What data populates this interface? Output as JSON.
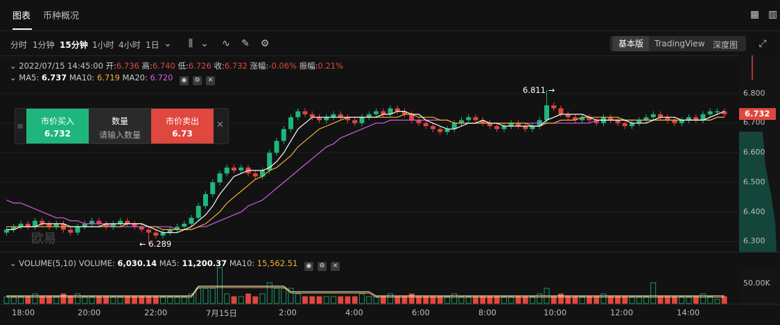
{
  "tabs": [
    {
      "label": "图表"
    },
    {
      "label": "币种概况"
    }
  ],
  "toolbar": {
    "timeframes": [
      "分时",
      "1分钟",
      "15分钟",
      "1小时",
      "4小时",
      "1日"
    ],
    "active_timeframe": "15分钟",
    "versions": [
      "基本版",
      "TradingView",
      "深度图"
    ],
    "active_version": "基本版"
  },
  "info": {
    "datetime": "2022/07/15 14:45:00",
    "open_label": "开:",
    "open": "6.736",
    "high_label": "高:",
    "high": "6.740",
    "low_label": "低:",
    "low": "6.726",
    "close_label": "收:",
    "close": "6.732",
    "change_label": "涨幅:",
    "change": "-0.06%",
    "amp_label": "振幅:",
    "amp": "0.21%",
    "ma5_label": "MA5:",
    "ma5": "6.737",
    "ma10_label": "MA10:",
    "ma10": "6.719",
    "ma20_label": "MA20:",
    "ma20": "6.720"
  },
  "trade": {
    "buy_label": "市价买入",
    "buy_price": "6.732",
    "qty_label": "数量",
    "qty_placeholder": "请输入数量",
    "sell_label": "市价卖出",
    "sell_price": "6.73"
  },
  "annotations": {
    "high_marker": "6.811 →",
    "low_marker": "← 6.289"
  },
  "current_price": "6.732",
  "watermark": "欧易",
  "price_axis": [
    "6.800",
    "6.700",
    "6.600",
    "6.500",
    "6.400",
    "6.300"
  ],
  "volume": {
    "header": "VOLUME(5,10)",
    "vol_label": "VOLUME:",
    "vol": "6,030.14",
    "ma5_label": "MA5:",
    "ma5": "11,200.37",
    "ma10_label": "MA10:",
    "ma10": "15,562.51",
    "axis": "50.00K"
  },
  "time_axis": [
    "18:00",
    "20:00",
    "22:00",
    "7月15日",
    "2:00",
    "4:00",
    "6:00",
    "8:00",
    "10:00",
    "12:00",
    "14:00"
  ],
  "colors": {
    "up": "#1fb67e",
    "down": "#e0473e",
    "ma5": "#ffffff",
    "ma10": "#f5b23c",
    "ma20": "#d35ee8"
  },
  "chart_data": {
    "type": "candlestick",
    "price_axis_ticks": [
      6.8,
      6.7,
      6.6,
      6.5,
      6.4,
      6.3
    ],
    "high_marked": 6.811,
    "low_marked": 6.289,
    "closes": [
      6.34,
      6.35,
      6.36,
      6.35,
      6.37,
      6.36,
      6.35,
      6.36,
      6.34,
      6.33,
      6.35,
      6.36,
      6.37,
      6.36,
      6.35,
      6.36,
      6.37,
      6.36,
      6.35,
      6.34,
      6.33,
      6.32,
      6.33,
      6.34,
      6.35,
      6.36,
      6.38,
      6.42,
      6.46,
      6.5,
      6.53,
      6.55,
      6.54,
      6.55,
      6.53,
      6.52,
      6.54,
      6.6,
      6.64,
      6.68,
      6.72,
      6.74,
      6.73,
      6.72,
      6.71,
      6.72,
      6.73,
      6.72,
      6.71,
      6.7,
      6.72,
      6.73,
      6.74,
      6.73,
      6.75,
      6.74,
      6.73,
      6.71,
      6.7,
      6.69,
      6.68,
      6.67,
      6.68,
      6.7,
      6.71,
      6.72,
      6.71,
      6.7,
      6.69,
      6.68,
      6.69,
      6.7,
      6.69,
      6.68,
      6.69,
      6.71,
      6.76,
      6.75,
      6.73,
      6.72,
      6.71,
      6.72,
      6.71,
      6.7,
      6.72,
      6.71,
      6.7,
      6.69,
      6.7,
      6.71,
      6.72,
      6.73,
      6.72,
      6.71,
      6.7,
      6.71,
      6.72,
      6.71,
      6.73,
      6.74,
      6.74,
      6.73
    ],
    "ma5": [
      6.34,
      6.34,
      6.35,
      6.35,
      6.35,
      6.36,
      6.36,
      6.36,
      6.36,
      6.35,
      6.35,
      6.35,
      6.35,
      6.35,
      6.36,
      6.36,
      6.36,
      6.36,
      6.36,
      6.36,
      6.35,
      6.34,
      6.33,
      6.33,
      6.33,
      6.34,
      6.35,
      6.37,
      6.39,
      6.42,
      6.46,
      6.49,
      6.52,
      6.53,
      6.54,
      6.54,
      6.54,
      6.55,
      6.57,
      6.6,
      6.64,
      6.68,
      6.7,
      6.72,
      6.72,
      6.72,
      6.72,
      6.72,
      6.72,
      6.72,
      6.72,
      6.72,
      6.72,
      6.73,
      6.73,
      6.74,
      6.74,
      6.73,
      6.73,
      6.71,
      6.7,
      6.69,
      6.68,
      6.68,
      6.69,
      6.7,
      6.7,
      6.71,
      6.7,
      6.7,
      6.69,
      6.69,
      6.69,
      6.69,
      6.69,
      6.69,
      6.71,
      6.72,
      6.73,
      6.73,
      6.73,
      6.73,
      6.72,
      6.71,
      6.71,
      6.71,
      6.71,
      6.71,
      6.7,
      6.7,
      6.7,
      6.71,
      6.72,
      6.72,
      6.72,
      6.71,
      6.71,
      6.71,
      6.71,
      6.72,
      6.73,
      6.74
    ],
    "ma10": [
      6.35,
      6.35,
      6.35,
      6.35,
      6.35,
      6.35,
      6.35,
      6.35,
      6.35,
      6.35,
      6.35,
      6.35,
      6.35,
      6.35,
      6.35,
      6.35,
      6.35,
      6.36,
      6.36,
      6.36,
      6.35,
      6.35,
      6.34,
      6.34,
      6.34,
      6.34,
      6.34,
      6.35,
      6.36,
      6.38,
      6.4,
      6.43,
      6.45,
      6.47,
      6.49,
      6.51,
      6.52,
      6.54,
      6.55,
      6.57,
      6.59,
      6.62,
      6.64,
      6.66,
      6.68,
      6.69,
      6.7,
      6.71,
      6.72,
      6.72,
      6.72,
      6.72,
      6.72,
      6.72,
      6.72,
      6.72,
      6.73,
      6.73,
      6.72,
      6.72,
      6.72,
      6.71,
      6.71,
      6.7,
      6.7,
      6.7,
      6.7,
      6.7,
      6.7,
      6.7,
      6.7,
      6.7,
      6.7,
      6.7,
      6.69,
      6.69,
      6.7,
      6.7,
      6.71,
      6.71,
      6.71,
      6.72,
      6.72,
      6.72,
      6.72,
      6.72,
      6.72,
      6.71,
      6.71,
      6.71,
      6.71,
      6.71,
      6.71,
      6.71,
      6.71,
      6.71,
      6.71,
      6.71,
      6.71,
      6.71,
      6.72,
      6.72
    ],
    "ma20": [
      6.44,
      6.43,
      6.43,
      6.42,
      6.41,
      6.4,
      6.39,
      6.38,
      6.38,
      6.37,
      6.37,
      6.36,
      6.36,
      6.36,
      6.36,
      6.35,
      6.35,
      6.35,
      6.35,
      6.35,
      6.35,
      6.35,
      6.35,
      6.35,
      6.34,
      6.34,
      6.34,
      6.35,
      6.35,
      6.36,
      6.37,
      6.38,
      6.39,
      6.4,
      6.42,
      6.43,
      6.44,
      6.46,
      6.48,
      6.5,
      6.52,
      6.54,
      6.56,
      6.58,
      6.6,
      6.62,
      6.63,
      6.65,
      6.66,
      6.67,
      6.68,
      6.69,
      6.7,
      6.7,
      6.71,
      6.71,
      6.71,
      6.71,
      6.71,
      6.71,
      6.71,
      6.71,
      6.71,
      6.7,
      6.7,
      6.7,
      6.7,
      6.7,
      6.7,
      6.7,
      6.7,
      6.7,
      6.7,
      6.7,
      6.7,
      6.7,
      6.7,
      6.7,
      6.7,
      6.7,
      6.7,
      6.7,
      6.7,
      6.71,
      6.71,
      6.71,
      6.71,
      6.71,
      6.71,
      6.71,
      6.71,
      6.71,
      6.71,
      6.71,
      6.71,
      6.71,
      6.71,
      6.71,
      6.71,
      6.71,
      6.72,
      6.72
    ],
    "volume_axis_tick": 50000
  }
}
